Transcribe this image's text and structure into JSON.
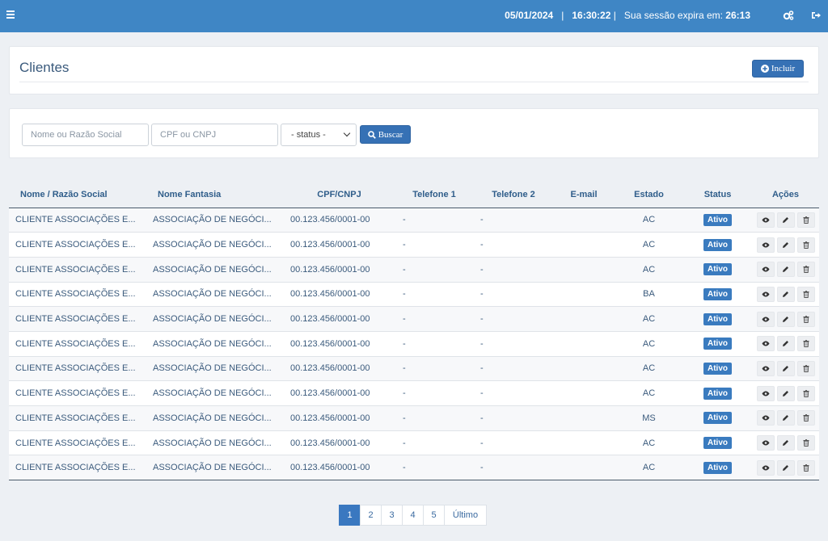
{
  "header": {
    "date": "05/01/2024",
    "time": "16:30:22",
    "session_label": "Sua sessão expira em:",
    "session_remaining": "26:13"
  },
  "page": {
    "title": "Clientes",
    "include_label": "Incluir"
  },
  "filters": {
    "name_placeholder": "Nome ou Razão Social",
    "doc_placeholder": "CPF ou CNPJ",
    "status_value": "- status -",
    "search_label": "Buscar"
  },
  "table": {
    "columns": [
      "Nome / Razão Social",
      "Nome Fantasia",
      "CPF/CNPJ",
      "Telefone 1",
      "Telefone 2",
      "E-mail",
      "Estado",
      "Status",
      "Ações"
    ],
    "rows": [
      {
        "nome": "CLIENTE ASSOCIAÇÕES E...",
        "fantasia": "ASSOCIAÇÃO DE NEGÓCI...",
        "cpf": "00.123.456/0001-00",
        "tel1": "-",
        "tel2": "-",
        "email": "",
        "estado": "AC",
        "status": "Ativo"
      },
      {
        "nome": "CLIENTE ASSOCIAÇÕES E...",
        "fantasia": "ASSOCIAÇÃO DE NEGÓCI...",
        "cpf": "00.123.456/0001-00",
        "tel1": "-",
        "tel2": "-",
        "email": "",
        "estado": "AC",
        "status": "Ativo"
      },
      {
        "nome": "CLIENTE ASSOCIAÇÕES E...",
        "fantasia": "ASSOCIAÇÃO DE NEGÓCI...",
        "cpf": "00.123.456/0001-00",
        "tel1": "-",
        "tel2": "-",
        "email": "",
        "estado": "AC",
        "status": "Ativo"
      },
      {
        "nome": "CLIENTE ASSOCIAÇÕES E...",
        "fantasia": "ASSOCIAÇÃO DE NEGÓCI...",
        "cpf": "00.123.456/0001-00",
        "tel1": "-",
        "tel2": "-",
        "email": "",
        "estado": "BA",
        "status": "Ativo"
      },
      {
        "nome": "CLIENTE ASSOCIAÇÕES E...",
        "fantasia": "ASSOCIAÇÃO DE NEGÓCI...",
        "cpf": "00.123.456/0001-00",
        "tel1": "-",
        "tel2": "-",
        "email": "",
        "estado": "AC",
        "status": "Ativo"
      },
      {
        "nome": "CLIENTE ASSOCIAÇÕES E...",
        "fantasia": "ASSOCIAÇÃO DE NEGÓCI...",
        "cpf": "00.123.456/0001-00",
        "tel1": "-",
        "tel2": "-",
        "email": "",
        "estado": "AC",
        "status": "Ativo"
      },
      {
        "nome": "CLIENTE ASSOCIAÇÕES E...",
        "fantasia": "ASSOCIAÇÃO DE NEGÓCI...",
        "cpf": "00.123.456/0001-00",
        "tel1": "-",
        "tel2": "-",
        "email": "",
        "estado": "AC",
        "status": "Ativo"
      },
      {
        "nome": "CLIENTE ASSOCIAÇÕES E...",
        "fantasia": "ASSOCIAÇÃO DE NEGÓCI...",
        "cpf": "00.123.456/0001-00",
        "tel1": "-",
        "tel2": "-",
        "email": "",
        "estado": "AC",
        "status": "Ativo"
      },
      {
        "nome": "CLIENTE ASSOCIAÇÕES E...",
        "fantasia": "ASSOCIAÇÃO DE NEGÓCI...",
        "cpf": "00.123.456/0001-00",
        "tel1": "-",
        "tel2": "-",
        "email": "",
        "estado": "MS",
        "status": "Ativo"
      },
      {
        "nome": "CLIENTE ASSOCIAÇÕES E...",
        "fantasia": "ASSOCIAÇÃO DE NEGÓCI...",
        "cpf": "00.123.456/0001-00",
        "tel1": "-",
        "tel2": "-",
        "email": "",
        "estado": "AC",
        "status": "Ativo"
      },
      {
        "nome": "CLIENTE ASSOCIAÇÕES E...",
        "fantasia": "ASSOCIAÇÃO DE NEGÓCI...",
        "cpf": "00.123.456/0001-00",
        "tel1": "-",
        "tel2": "-",
        "email": "",
        "estado": "AC",
        "status": "Ativo"
      }
    ],
    "action_icons": [
      "eye-icon",
      "pencil-icon",
      "trash-icon"
    ]
  },
  "pagination": {
    "pages": [
      "1",
      "2",
      "3",
      "4",
      "5"
    ],
    "active": "1",
    "last_label": "Último"
  },
  "colors": {
    "topbar": "#3f86c5",
    "primary": "#3671b5",
    "badge": "#3a7bbf"
  }
}
